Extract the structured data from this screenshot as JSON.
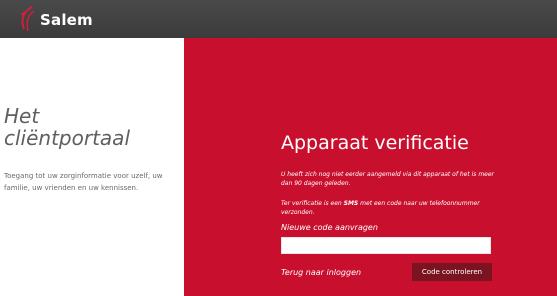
{
  "header": {
    "brand": "Salem",
    "logo_icon": "salem-swirl-icon",
    "background": "#3f3f3f"
  },
  "left": {
    "title_line1": "Het",
    "title_line2": "cliëntportaal",
    "description": "Toegang tot uw zorginformatie voor uzelf, uw familie, uw vrienden en uw kennissen."
  },
  "right": {
    "background": "#c8102e",
    "title": "Apparaat verificatie",
    "notice": "U heeft zich nog niet eerder aangemeld via dit apparaat of het is meer dan 90 dagen geleden.",
    "sms_prefix": "Ter verificatie is een ",
    "sms_bold": "SMS",
    "sms_suffix": " met een code naar uw telefoonnummer verzonden.",
    "new_code_link": "Nieuwe code aanvragen",
    "code_input": {
      "value": "",
      "placeholder": ""
    },
    "back_link": "Terug naar inloggen",
    "check_button": "Code controleren",
    "button_color": "#7a1420"
  }
}
